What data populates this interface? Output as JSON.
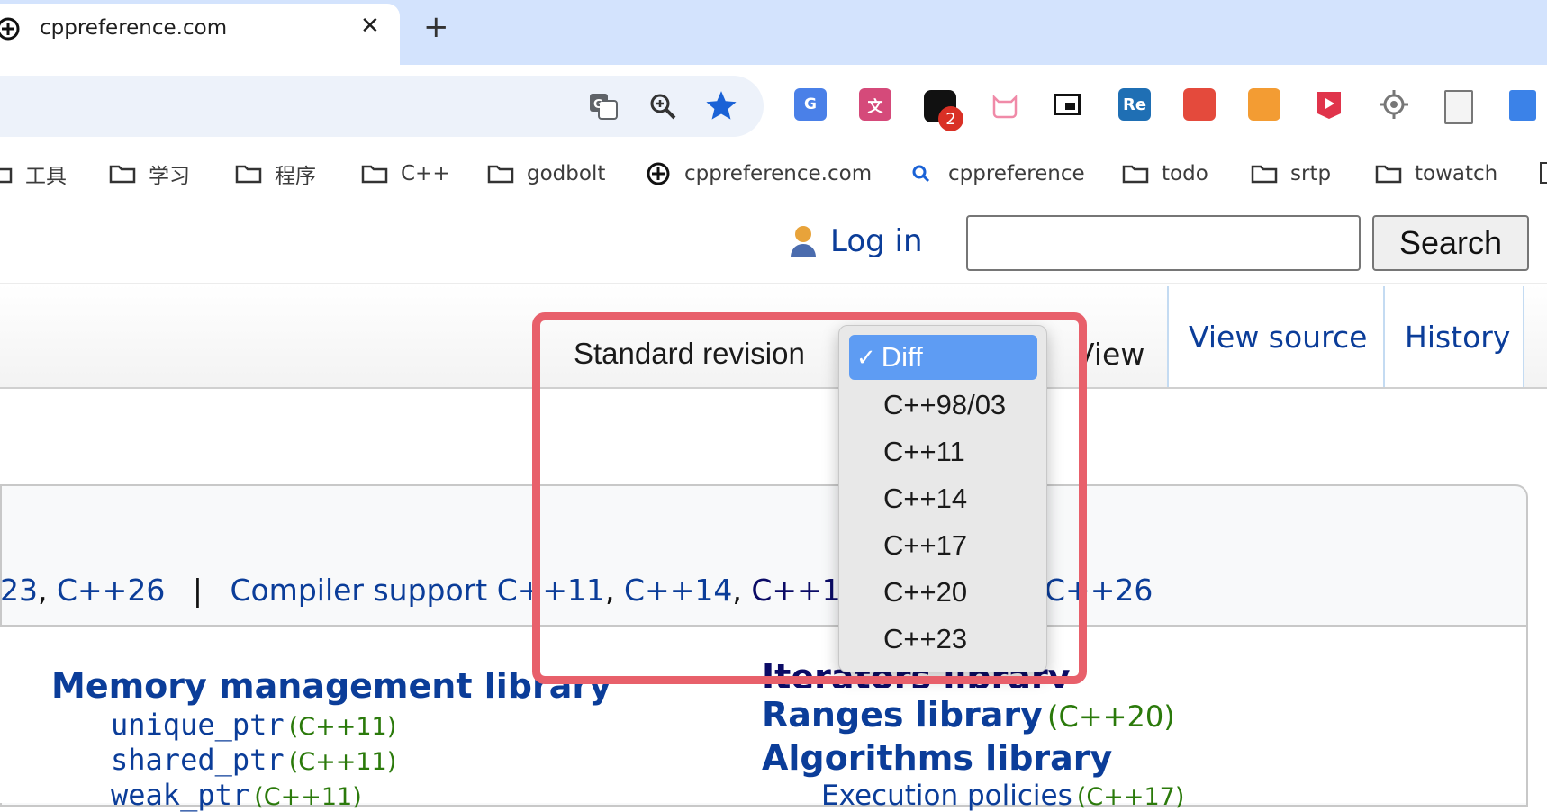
{
  "browser": {
    "tab_title": "cppreference.com",
    "close_glyph": "✕",
    "new_tab_glyph": "+",
    "extension_badge": "2",
    "extension_re_label": "Re"
  },
  "bookmarks": {
    "items": [
      "工具",
      "学习",
      "程序",
      "C++",
      "godbolt",
      "cppreference.com",
      "cppreference",
      "todo",
      "srtp",
      "towatch"
    ]
  },
  "header": {
    "login_label": "Log in",
    "search_value": "",
    "search_button": "Search"
  },
  "tabs": {
    "standard_revision_label": "Standard revision",
    "view_label": "View",
    "view_source_label": "View source",
    "history_label": "History"
  },
  "dropdown": {
    "check_glyph": "✓",
    "selected": "Diff",
    "options": [
      "Diff",
      "C++98/03",
      "C++11",
      "C++14",
      "C++17",
      "C++20",
      "C++23"
    ]
  },
  "content": {
    "versions_tail": "23",
    "versions_last": "C++26",
    "separator": "|",
    "compiler_support_label": "Compiler support",
    "cs_11": "C++11",
    "cs_14": "C++14",
    "cs_17": "C++17",
    "cs_20_partial": "C+",
    "cs_26_partial": "C++26",
    "memory_header": "Memory management library",
    "memory_items": [
      {
        "name": "unique_ptr",
        "rev": "(C++11)"
      },
      {
        "name": "shared_ptr",
        "rev": "(C++11)"
      },
      {
        "name": "weak_ptr",
        "rev": "(C++11)"
      }
    ],
    "iterators_header": "Iterators library",
    "ranges_header": "Ranges library",
    "ranges_rev": "(C++20)",
    "algorithms_header": "Algorithms library",
    "execution_policies": "Execution policies",
    "execution_rev": "(C++17)"
  },
  "colors": {
    "link": "#0b3d99",
    "revision_green": "#2b7a0b",
    "highlight": "#e8606b",
    "dropdown_selected": "#5e9cf3"
  }
}
